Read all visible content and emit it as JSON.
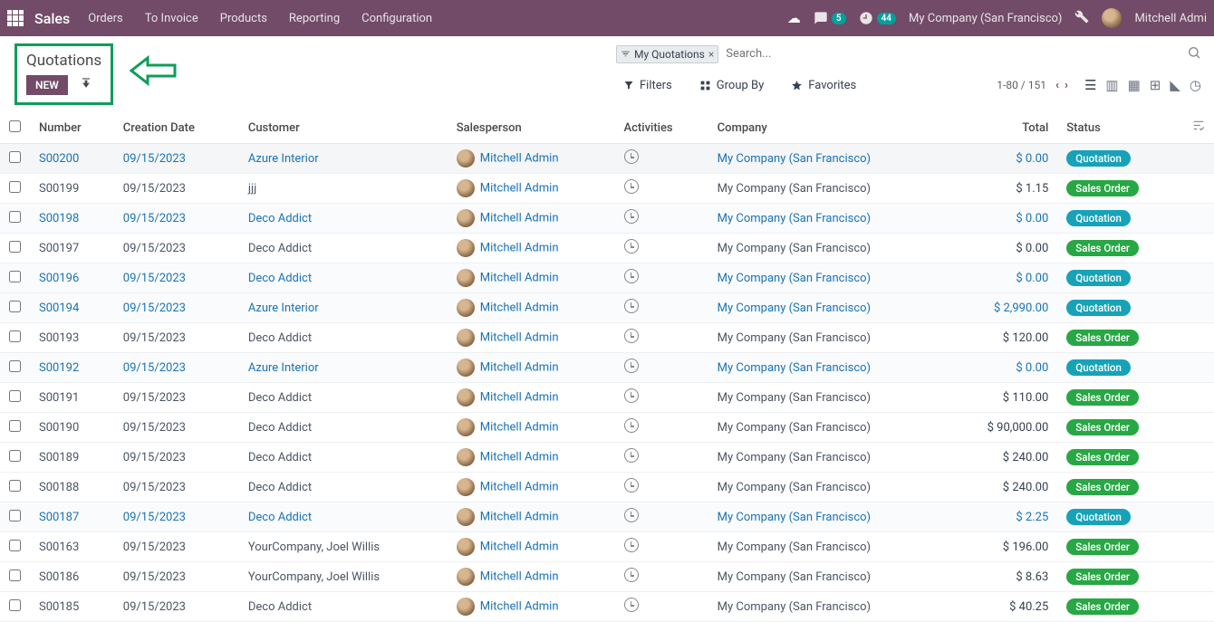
{
  "topbar": {
    "app": "Sales",
    "nav": [
      "Orders",
      "To Invoice",
      "Products",
      "Reporting",
      "Configuration"
    ],
    "msg_count": "5",
    "clock_count": "44",
    "company": "My Company (San Francisco)",
    "user": "Mitchell Admi"
  },
  "header": {
    "title": "Quotations",
    "new_btn": "NEW"
  },
  "search": {
    "chip": "My Quotations",
    "placeholder": "Search..."
  },
  "toolbar": {
    "filters": "Filters",
    "groupby": "Group By",
    "favorites": "Favorites",
    "pager": "1-80 / 151"
  },
  "columns": {
    "number": "Number",
    "date": "Creation Date",
    "customer": "Customer",
    "salesperson": "Salesperson",
    "activities": "Activities",
    "company": "Company",
    "total": "Total",
    "status": "Status"
  },
  "rows": [
    {
      "num": "S00200",
      "date": "09/15/2023",
      "cust": "Azure Interior",
      "sp": "Mitchell Admin",
      "comp": "My Company (San Francisco)",
      "total": "$ 0.00",
      "status": "Quotation",
      "linked": true,
      "hl": true
    },
    {
      "num": "S00199",
      "date": "09/15/2023",
      "cust": "jjj",
      "sp": "Mitchell Admin",
      "comp": "My Company (San Francisco)",
      "total": "$ 1.15",
      "status": "Sales Order",
      "linked": false
    },
    {
      "num": "S00198",
      "date": "09/15/2023",
      "cust": "Deco Addict",
      "sp": "Mitchell Admin",
      "comp": "My Company (San Francisco)",
      "total": "$ 0.00",
      "status": "Quotation",
      "linked": true,
      "hl2": true
    },
    {
      "num": "S00197",
      "date": "09/15/2023",
      "cust": "Deco Addict",
      "sp": "Mitchell Admin",
      "comp": "My Company (San Francisco)",
      "total": "$ 0.00",
      "status": "Sales Order",
      "linked": false
    },
    {
      "num": "S00196",
      "date": "09/15/2023",
      "cust": "Deco Addict",
      "sp": "Mitchell Admin",
      "comp": "My Company (San Francisco)",
      "total": "$ 0.00",
      "status": "Quotation",
      "linked": true,
      "hl2": true
    },
    {
      "num": "S00194",
      "date": "09/15/2023",
      "cust": "Azure Interior",
      "sp": "Mitchell Admin",
      "comp": "My Company (San Francisco)",
      "total": "$ 2,990.00",
      "status": "Quotation",
      "linked": true,
      "hl2": true
    },
    {
      "num": "S00193",
      "date": "09/15/2023",
      "cust": "Deco Addict",
      "sp": "Mitchell Admin",
      "comp": "My Company (San Francisco)",
      "total": "$ 120.00",
      "status": "Sales Order",
      "linked": false
    },
    {
      "num": "S00192",
      "date": "09/15/2023",
      "cust": "Azure Interior",
      "sp": "Mitchell Admin",
      "comp": "My Company (San Francisco)",
      "total": "$ 0.00",
      "status": "Quotation",
      "linked": true,
      "hl2": true
    },
    {
      "num": "S00191",
      "date": "09/15/2023",
      "cust": "Deco Addict",
      "sp": "Mitchell Admin",
      "comp": "My Company (San Francisco)",
      "total": "$ 110.00",
      "status": "Sales Order",
      "linked": false
    },
    {
      "num": "S00190",
      "date": "09/15/2023",
      "cust": "Deco Addict",
      "sp": "Mitchell Admin",
      "comp": "My Company (San Francisco)",
      "total": "$ 90,000.00",
      "status": "Sales Order",
      "linked": false
    },
    {
      "num": "S00189",
      "date": "09/15/2023",
      "cust": "Deco Addict",
      "sp": "Mitchell Admin",
      "comp": "My Company (San Francisco)",
      "total": "$ 240.00",
      "status": "Sales Order",
      "linked": false
    },
    {
      "num": "S00188",
      "date": "09/15/2023",
      "cust": "Deco Addict",
      "sp": "Mitchell Admin",
      "comp": "My Company (San Francisco)",
      "total": "$ 240.00",
      "status": "Sales Order",
      "linked": false
    },
    {
      "num": "S00187",
      "date": "09/15/2023",
      "cust": "Deco Addict",
      "sp": "Mitchell Admin",
      "comp": "My Company (San Francisco)",
      "total": "$ 2.25",
      "status": "Quotation",
      "linked": true,
      "hl2": true
    },
    {
      "num": "S00163",
      "date": "09/15/2023",
      "cust": "YourCompany, Joel Willis",
      "sp": "Mitchell Admin",
      "comp": "My Company (San Francisco)",
      "total": "$ 196.00",
      "status": "Sales Order",
      "linked": false
    },
    {
      "num": "S00186",
      "date": "09/15/2023",
      "cust": "YourCompany, Joel Willis",
      "sp": "Mitchell Admin",
      "comp": "My Company (San Francisco)",
      "total": "$ 8.63",
      "status": "Sales Order",
      "linked": false
    },
    {
      "num": "S00185",
      "date": "09/15/2023",
      "cust": "Deco Addict",
      "sp": "Mitchell Admin",
      "comp": "My Company (San Francisco)",
      "total": "$ 40.25",
      "status": "Sales Order",
      "linked": false
    }
  ]
}
